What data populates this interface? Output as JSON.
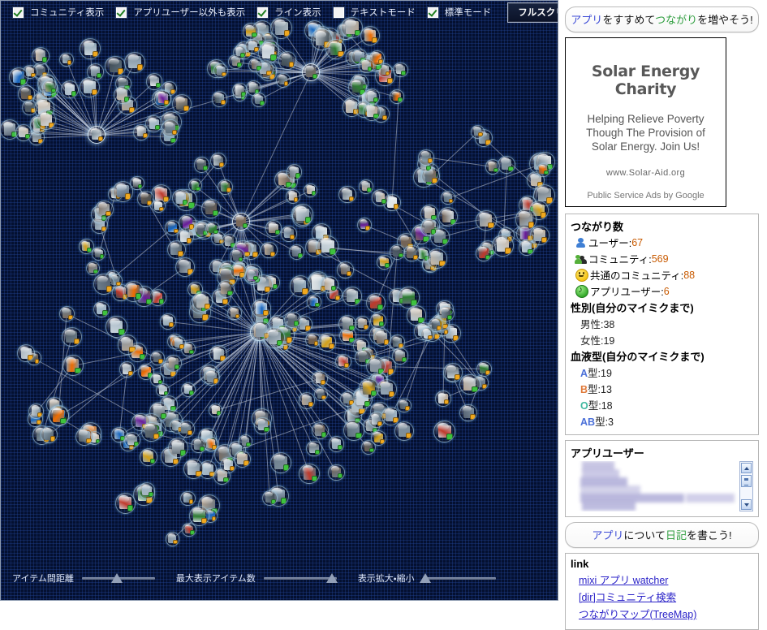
{
  "toolbar": {
    "checkboxes": [
      {
        "label": "コミュニティ表示",
        "checked": true,
        "name": "show-community"
      },
      {
        "label": "アプリユーザー以外も表示",
        "checked": true,
        "name": "show-non-app-users"
      },
      {
        "label": "ライン表示",
        "checked": true,
        "name": "show-lines"
      },
      {
        "label": "テキストモード",
        "checked": false,
        "name": "text-mode"
      },
      {
        "label": "標準モード",
        "checked": true,
        "name": "standard-mode"
      }
    ],
    "fullscreen_label": "フルスクリーン表示"
  },
  "sliders": [
    {
      "label": "アイテム間距離",
      "name": "item-distance",
      "value_pct": 48
    },
    {
      "label": "最大表示アイテム数",
      "name": "max-items",
      "value_pct": 94
    },
    {
      "label": "表示拡大・縮小",
      "name": "zoom-scale",
      "value_pct": 4
    }
  ],
  "sidebar": {
    "promo_button": {
      "part1": "アプリ",
      "part2": "をすすめて",
      "part3": "つながり",
      "part4": "を増やそう!"
    },
    "ad": {
      "title": "Solar Energy Charity",
      "line1": "Helping Relieve Poverty",
      "line2": "Though The Provision of",
      "line3": "Solar Energy. Join Us!",
      "url": "www.Solar-Aid.org",
      "footer": "Public Service Ads by Google"
    },
    "stats": {
      "connections_heading": "つながり数",
      "connections": [
        {
          "icon": "user-icon",
          "label": "ユーザー:",
          "value": "67"
        },
        {
          "icon": "community-icon",
          "label": "コミュニティ:",
          "value": "569"
        },
        {
          "icon": "smiley-icon",
          "label": "共通のコミュニティ:",
          "value": "88"
        },
        {
          "icon": "app-user-icon",
          "label": "アプリユーザー:",
          "value": "6"
        }
      ],
      "gender_heading": "性別(自分のマイミクまで)",
      "gender": [
        {
          "label": "男性:38"
        },
        {
          "label": "女性:19"
        }
      ],
      "blood_heading": "血液型(自分のマイミクまで)",
      "blood": [
        {
          "type": "A",
          "suffix": "型:19",
          "cls": "bt-a"
        },
        {
          "type": "B",
          "suffix": "型:13",
          "cls": "bt-b"
        },
        {
          "type": "O",
          "suffix": "型:18",
          "cls": "bt-o"
        },
        {
          "type": "AB",
          "suffix": "型:3",
          "cls": "bt-ab"
        }
      ]
    },
    "applist_heading": "アプリユーザー",
    "diary_button": {
      "part1": "アプリ",
      "part2": "について",
      "part3": "日記",
      "part4": "を書こう!"
    },
    "link_heading": "link",
    "links": [
      {
        "label": "mixi アプリ watcher"
      },
      {
        "label": "[dir]コミュニティ検索"
      },
      {
        "label": "つながりマップ(TreeMap)"
      }
    ]
  },
  "graph": {
    "background_color": "#041030",
    "node_count_visible": 330,
    "hub_count": 5
  }
}
